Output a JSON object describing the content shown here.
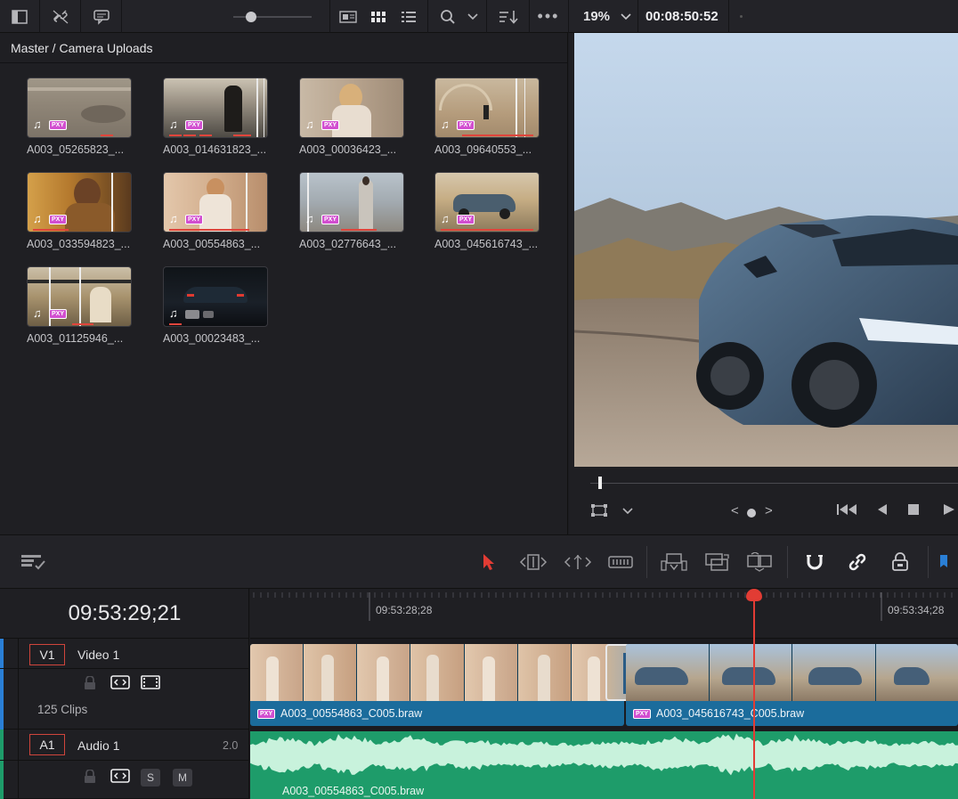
{
  "toolbar": {
    "zoom": "19%",
    "timecode": "00:08:50:52",
    "icons": [
      "panel-toggle-icon",
      "link-icon",
      "metadata-icon",
      "thumbnail-view-icon",
      "grid-view-icon",
      "list-view-icon",
      "search-icon",
      "chevron-down-icon",
      "sort-icon",
      "more-icon"
    ]
  },
  "media_pool": {
    "breadcrumb": "Master / Camera Uploads",
    "clips": [
      {
        "name": "A003_05265823_...",
        "badge": "PXY"
      },
      {
        "name": "A003_014631823_...",
        "badge": "PXY"
      },
      {
        "name": "A003_00036423_...",
        "badge": "PXY"
      },
      {
        "name": "A003_09640553_...",
        "badge": "PXY"
      },
      {
        "name": "A003_033594823_...",
        "badge": "PXY"
      },
      {
        "name": "A003_00554863_...",
        "badge": "PXY"
      },
      {
        "name": "A003_02776643_...",
        "badge": "PXY"
      },
      {
        "name": "A003_045616743_...",
        "badge": "PXY"
      },
      {
        "name": "A003_01125946_...",
        "badge": "PXY"
      },
      {
        "name": "A003_00023483_...",
        "badge": ""
      }
    ]
  },
  "viewer": {
    "nav": "<",
    "nav_next": ">"
  },
  "timeline": {
    "timecode": "09:53:29;21",
    "ruler": [
      "09:53:28;28",
      "09:53:34;28"
    ],
    "tracks": {
      "v1": {
        "tag": "V1",
        "name": "Video 1",
        "clip_count": "125 Clips"
      },
      "a1": {
        "tag": "A1",
        "name": "Audio 1",
        "channels": "2.0",
        "solo": "S",
        "mute": "M"
      }
    },
    "video_clips": [
      {
        "name": "A003_00554863_C005.braw",
        "badge": "PXY"
      },
      {
        "name": "A003_045616743_C005.braw",
        "badge": "PXY"
      }
    ],
    "audio_clip": "A003_00554863_C005.braw"
  },
  "colors": {
    "accent_red": "#e23c34",
    "video_clip": "#1b6c9c",
    "audio_clip": "#1e9c6a",
    "proxy_badge": "#d24fd0"
  }
}
